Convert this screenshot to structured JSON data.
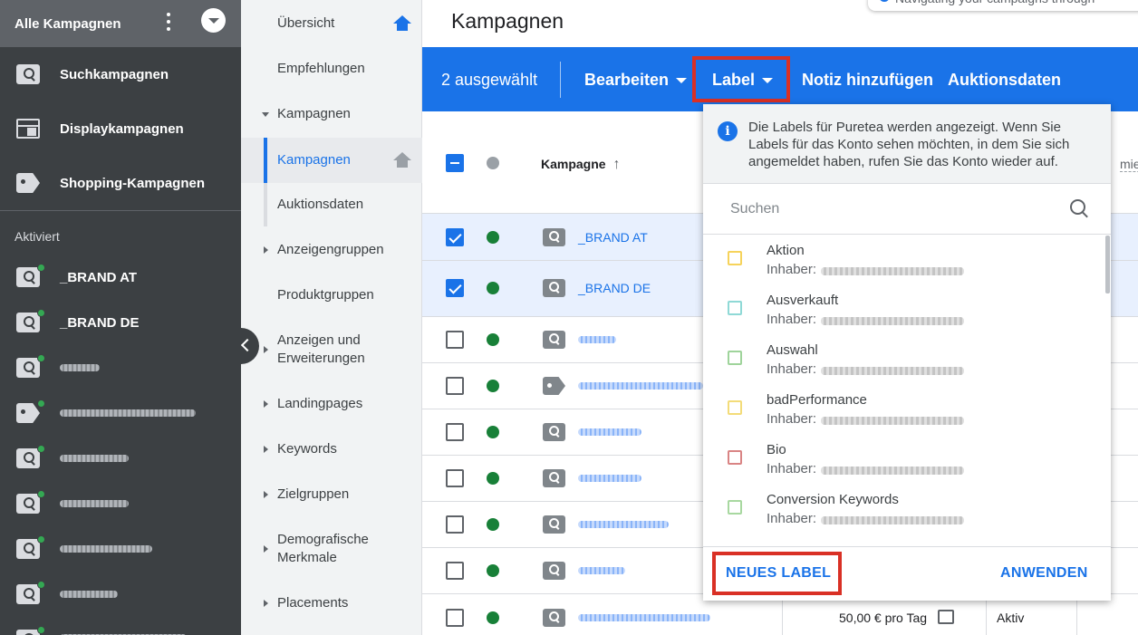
{
  "account_switcher": {
    "title": "Alle Kampagnen"
  },
  "sidebar": {
    "types": [
      {
        "label": "Suchkampagnen",
        "icon": "search-icon"
      },
      {
        "label": "Displaykampagnen",
        "icon": "display-icon"
      },
      {
        "label": "Shopping-Kampagnen",
        "icon": "tag-icon"
      }
    ],
    "section_label": "Aktiviert",
    "campaigns": [
      {
        "label": "_BRAND AT",
        "icon": "search-icon"
      },
      {
        "label": "_BRAND DE",
        "icon": "search-icon"
      }
    ]
  },
  "nav": {
    "items": [
      {
        "label": "Übersicht"
      },
      {
        "label": "Empfehlungen"
      },
      {
        "label": "Kampagnen"
      },
      {
        "label": "Kampagnen"
      },
      {
        "label": "Auktionsdaten"
      },
      {
        "label": "Anzeigengruppen"
      },
      {
        "label": "Produktgruppen"
      },
      {
        "label": "Anzeigen und Erweiterungen"
      },
      {
        "label": "Landingpages"
      },
      {
        "label": "Keywords"
      },
      {
        "label": "Zielgruppen"
      },
      {
        "label": "Demografische Merkmale"
      },
      {
        "label": "Placements"
      }
    ]
  },
  "main": {
    "title": "Kampagnen",
    "toast": "Navigating your campaigns through"
  },
  "toolbar": {
    "selected": "2 ausgewählt",
    "edit": "Bearbeiten",
    "label": "Label",
    "note": "Notiz hinzufügen",
    "auction": "Auktionsdaten"
  },
  "table": {
    "campaign_header": "Kampagne",
    "truncated_header": "mier",
    "rows": [
      {
        "name": "_BRAND AT"
      },
      {
        "name": "_BRAND DE"
      }
    ],
    "budget": "50,00 € pro Tag",
    "status": "Aktiv"
  },
  "label_panel": {
    "info": "Die Labels für Puretea werden angezeigt. Wenn Sie Labels für das Konto sehen möchten, in dem Sie sich angemeldet haben, rufen Sie das Konto wieder auf.",
    "search_placeholder": "Suchen",
    "owner_prefix": "Inhaber:",
    "labels": [
      {
        "name": "Aktion",
        "color": "#f6d35b"
      },
      {
        "name": "Ausverkauft",
        "color": "#8fd9d6"
      },
      {
        "name": "Auswahl",
        "color": "#9fd49b"
      },
      {
        "name": "badPerformance",
        "color": "#f3dc79"
      },
      {
        "name": "Bio",
        "color": "#d98484"
      },
      {
        "name": "Conversion Keywords",
        "color": "#a8d8a0"
      }
    ],
    "new_label": "NEUES LABEL",
    "apply": "ANWENDEN"
  }
}
